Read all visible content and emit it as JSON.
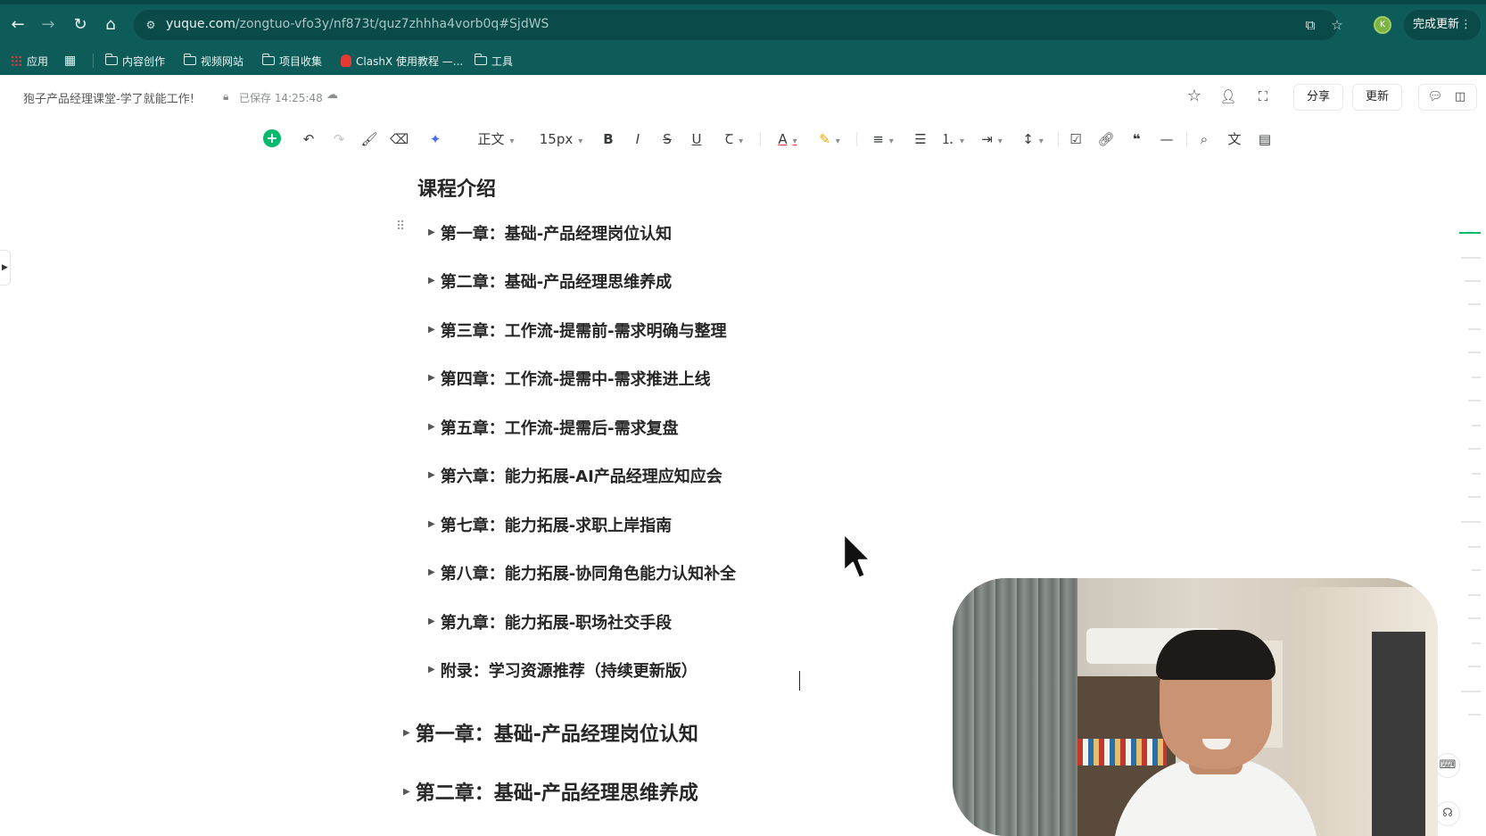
{
  "browser": {
    "url_host": "yuque.com",
    "url_path": "/zongtuo-vfo3y/nf873t/quz7zhhha4vorb0q#SjdWS",
    "update_label": "完成更新",
    "profile_initial": "K",
    "bookmarks": [
      {
        "label": "应用",
        "icon": "apps-grid-icon"
      },
      {
        "label": "",
        "icon": "grid-icon"
      },
      {
        "label": "内容创作",
        "icon": "folder-icon"
      },
      {
        "label": "视频网站",
        "icon": "folder-icon"
      },
      {
        "label": "项目收集",
        "icon": "folder-icon"
      },
      {
        "label": "ClashX 使用教程 —...",
        "icon": "clash-icon"
      },
      {
        "label": "工具",
        "icon": "folder-icon"
      }
    ]
  },
  "header": {
    "doc_title": "狍子产品经理课堂-学了就能工作!",
    "saved_status": "已保存 14:25:48",
    "share_label": "分享",
    "update_label": "更新"
  },
  "toolbar": {
    "style_label": "正文",
    "font_size": "15px",
    "bold": "B",
    "italic": "I",
    "strike": "S",
    "underline": "U",
    "font_color": "A"
  },
  "document": {
    "heading": "课程介绍",
    "toc": [
      "第一章：基础-产品经理岗位认知",
      "第二章：基础-产品经理思维养成",
      "第三章：工作流-提需前-需求明确与整理",
      "第四章：工作流-提需中-需求推进上线",
      "第五章：工作流-提需后-需求复盘",
      "第六章：能力拓展-AI产品经理应知应会",
      "第七章：能力拓展-求职上岸指南",
      "第八章：能力拓展-协同角色能力认知补全",
      "第九章：能力拓展-职场社交手段",
      "附录：学习资源推荐（持续更新版）"
    ],
    "sections": [
      "第一章：基础-产品经理岗位认知",
      "第二章：基础-产品经理思维养成"
    ]
  },
  "colors": {
    "chrome": "#0d5c5a",
    "accent": "#00b96b",
    "text": "#262626"
  }
}
